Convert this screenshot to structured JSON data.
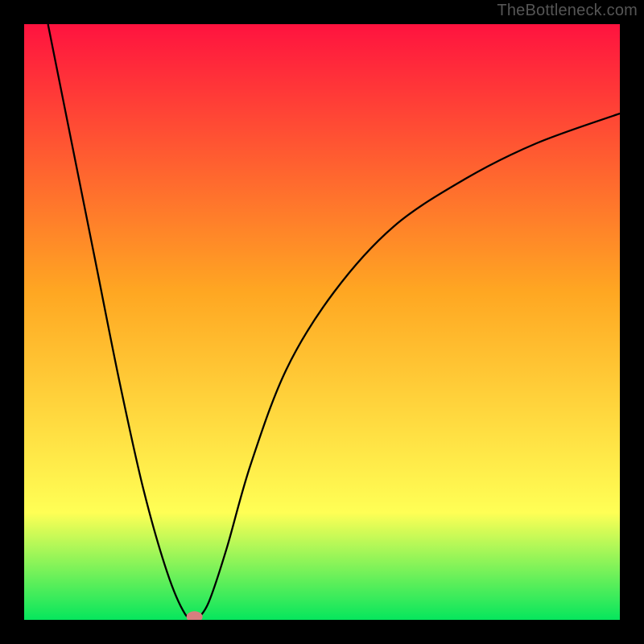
{
  "watermark": "TheBottleneck.com",
  "colors": {
    "frame": "#000000",
    "gradient_top": "#ff133f",
    "gradient_mid": "#ffa722",
    "gradient_low": "#ffff55",
    "gradient_bottom": "#06e65d",
    "curve": "#000000",
    "marker": "#d77e7f"
  },
  "chart_data": {
    "type": "line",
    "title": "",
    "xlabel": "",
    "ylabel": "",
    "x_range": [
      0,
      100
    ],
    "y_range": [
      0,
      100
    ],
    "curve_left": {
      "x": [
        4,
        8,
        12,
        16,
        20,
        24,
        27,
        29
      ],
      "y": [
        100,
        80,
        60,
        40,
        22,
        8,
        1,
        0
      ]
    },
    "curve_right": {
      "x": [
        29,
        31,
        34,
        38,
        44,
        52,
        62,
        74,
        86,
        100
      ],
      "y": [
        0,
        3,
        12,
        26,
        42,
        55,
        66,
        74,
        80,
        85
      ]
    },
    "marker": {
      "x": 28.6,
      "y": 0.5
    },
    "annotations": []
  }
}
